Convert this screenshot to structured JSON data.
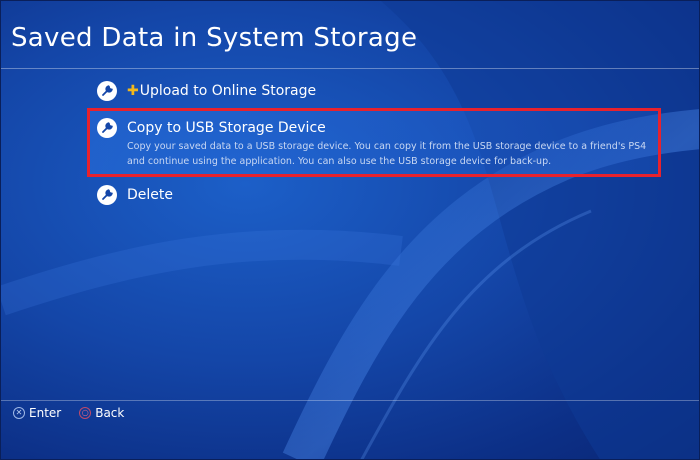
{
  "header": {
    "title": "Saved Data in System Storage"
  },
  "menu": {
    "upload": {
      "label": "Upload to Online Storage",
      "icon": "wrench-icon",
      "badge": "playstation-plus-icon"
    },
    "copy": {
      "label": "Copy to USB Storage Device",
      "description": "Copy your saved data to a USB storage device. You can copy it from the USB storage device to a friend's PS4 and continue using the application. You can also use the USB storage device for back-up.",
      "icon": "wrench-icon",
      "highlight_color": "#e8222d"
    },
    "delete": {
      "label": "Delete",
      "icon": "wrench-icon"
    }
  },
  "footer": {
    "enter_label": "Enter",
    "back_label": "Back",
    "enter_icon": "cross-button-icon",
    "back_icon": "circle-button-icon"
  },
  "colors": {
    "background": "#1446a8",
    "text": "#ffffff",
    "plus": "#f3b81a"
  }
}
